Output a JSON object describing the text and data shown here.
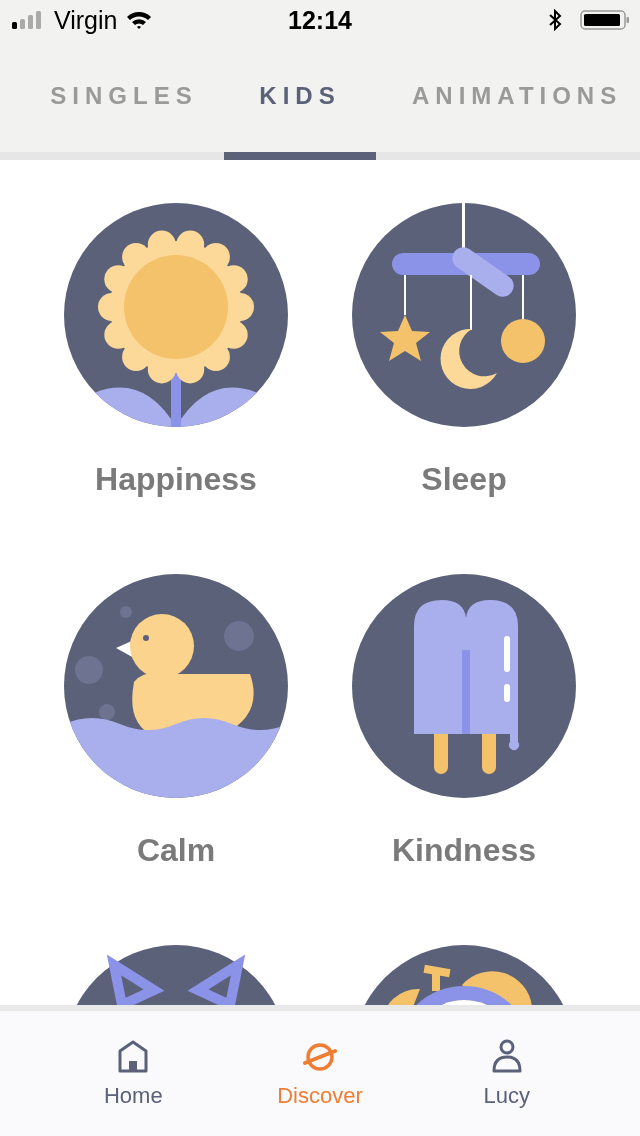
{
  "status_bar": {
    "carrier": "Virgin",
    "time": "12:14"
  },
  "tabs": [
    {
      "label": "SINGLES",
      "selected": false
    },
    {
      "label": "KIDS",
      "selected": true
    },
    {
      "label": "ANIMATIONS",
      "selected": false
    }
  ],
  "categories": [
    {
      "kind": "sunflower",
      "name": "Happiness"
    },
    {
      "kind": "mobile",
      "name": "Sleep"
    },
    {
      "kind": "duck",
      "name": "Calm"
    },
    {
      "kind": "popsicle",
      "name": "Kindness"
    },
    {
      "kind": "cat"
    },
    {
      "kind": "alarm"
    }
  ],
  "nav": [
    {
      "kind": "home",
      "label": "Home",
      "selected": false
    },
    {
      "kind": "discover",
      "label": "Discover",
      "selected": true
    },
    {
      "kind": "profile",
      "label": "Lucy",
      "selected": false
    }
  ]
}
